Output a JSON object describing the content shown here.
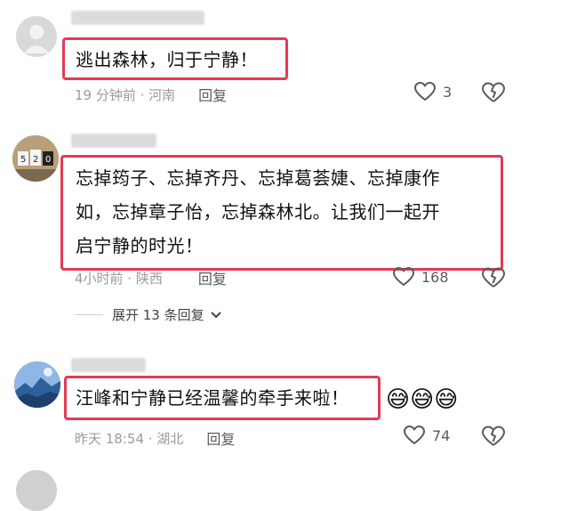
{
  "comments": [
    {
      "text": "逃出森林，归于宁静！",
      "meta_time": "19 分钟前 · 河南",
      "reply_label": "回复",
      "like_count": "3",
      "like_icon": "heart-outline-icon",
      "dislike_icon": "broken-heart-icon"
    },
    {
      "text_line1": "忘掉筠子、忘掉齐丹、忘掉葛荟婕、忘掉康作",
      "text_line2": "如，忘掉章子怡，忘掉森林北。让我们一起开",
      "text_line3": "启宁静的时光！",
      "meta_time": "4小时前 · 陕西",
      "reply_label": "回复",
      "like_count": "168",
      "expand_label": "展开 13 条回复",
      "expand_icon": "chevron-down-icon"
    },
    {
      "text": "汪峰和宁静已经温馨的牵手来啦！",
      "emojis": "😅😅😅",
      "meta_time": "昨天 18:54 · 湖北",
      "reply_label": "回复",
      "like_count": "74"
    }
  ],
  "colors": {
    "highlight_border": "#e53955",
    "meta_text": "#9b9b9b",
    "icon": "#5a5a5a"
  }
}
